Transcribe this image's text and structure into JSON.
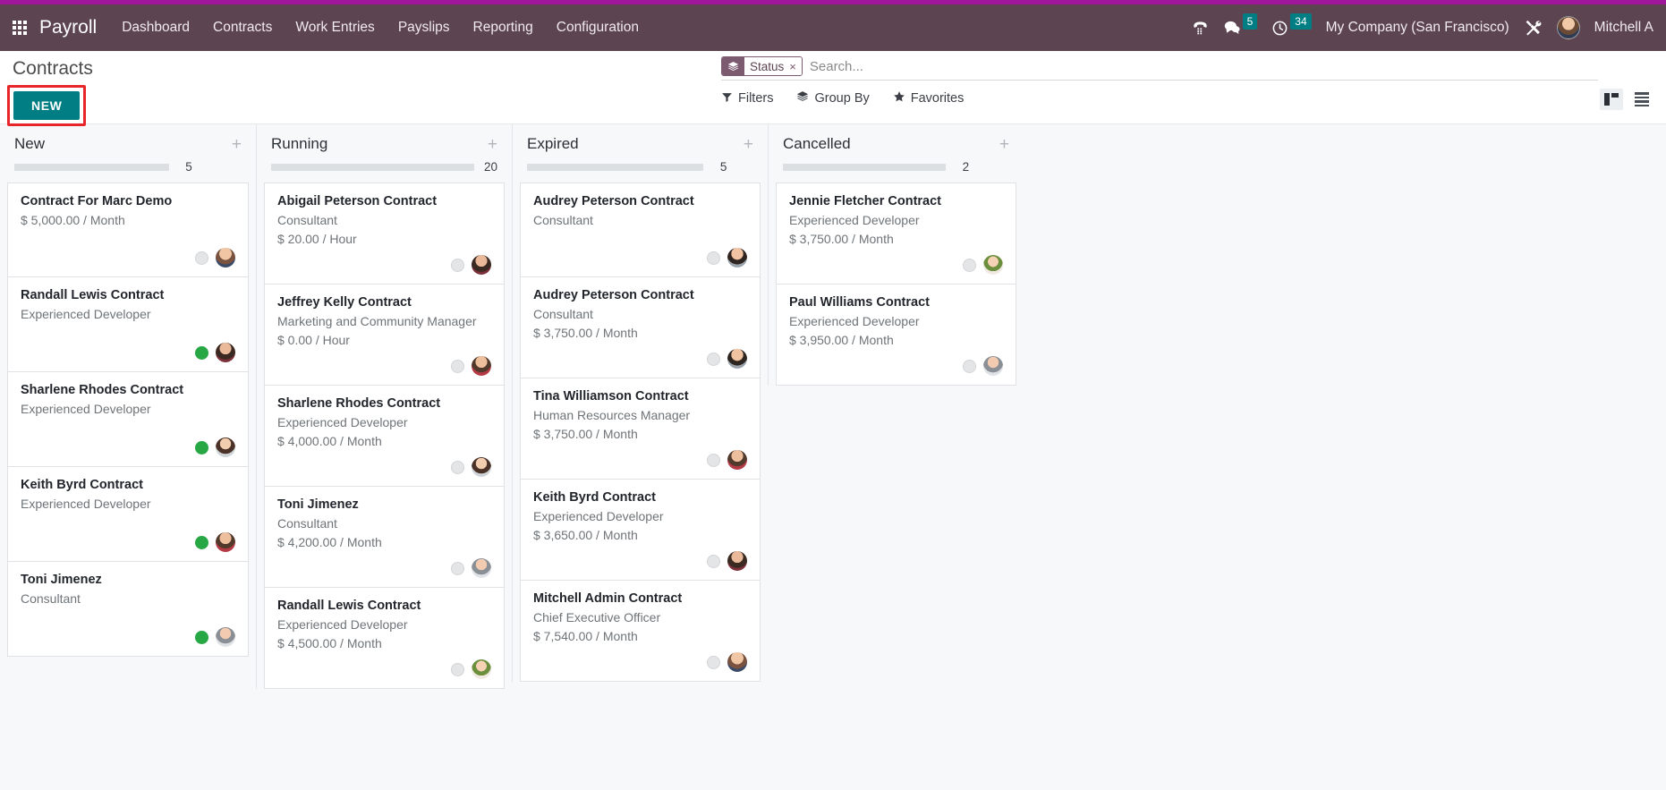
{
  "navbar": {
    "apps_icon": "apps-grid-icon",
    "brand": "Payroll",
    "menu": [
      {
        "label": "Dashboard"
      },
      {
        "label": "Contracts"
      },
      {
        "label": "Work Entries"
      },
      {
        "label": "Payslips"
      },
      {
        "label": "Reporting"
      },
      {
        "label": "Configuration"
      }
    ],
    "phone_icon": "phone-dialpad-icon",
    "messages_icon": "chat-bubble-icon",
    "messages_count": "5",
    "activities_icon": "clock-icon",
    "activities_count": "34",
    "company": "My Company (San Francisco)",
    "tools_icon": "wrench-screwdriver-icon",
    "user": "Mitchell A",
    "badge_color": "#017e84",
    "bar_color": "#5c4451",
    "strip_color": "#a0169b"
  },
  "control_panel": {
    "title": "Contracts",
    "new_button": "NEW",
    "new_button_color": "#017e84",
    "highlight_color": "#e8262a",
    "facet": {
      "icon": "layers-icon",
      "label": "Status",
      "remove": "×"
    },
    "search_placeholder": "Search...",
    "search_value": "",
    "filters": [
      {
        "icon": "funnel-icon",
        "label": "Filters"
      },
      {
        "icon": "layers-icon",
        "label": "Group By"
      },
      {
        "icon": "star-icon",
        "label": "Favorites"
      }
    ],
    "views": [
      {
        "icon": "kanban-view-icon",
        "active": true
      },
      {
        "icon": "list-view-icon",
        "active": false
      }
    ]
  },
  "kanban": {
    "add_label": "+",
    "columns": [
      {
        "title": "New",
        "count": "5",
        "progress_width": "68%",
        "cards": [
          {
            "title": "Contract For Marc Demo",
            "position": "",
            "amount": "$ 5,000.00 / Month",
            "status": "empty",
            "avatar": "av1"
          },
          {
            "title": "Randall Lewis Contract",
            "position": "Experienced Developer",
            "amount": "",
            "status": "green",
            "avatar": "av2"
          },
          {
            "title": "Sharlene Rhodes Contract",
            "position": "Experienced Developer",
            "amount": "",
            "status": "green",
            "avatar": "av3"
          },
          {
            "title": "Keith Byrd Contract",
            "position": "Experienced Developer",
            "amount": "",
            "status": "green",
            "avatar": "av6"
          },
          {
            "title": "Toni Jimenez",
            "position": "Consultant",
            "amount": "",
            "status": "green",
            "avatar": "av7"
          }
        ]
      },
      {
        "title": "Running",
        "count": "20",
        "progress_width": "100%",
        "cards": [
          {
            "title": "Abigail Peterson Contract",
            "position": "Consultant",
            "amount": "$ 20.00 / Hour",
            "status": "empty",
            "avatar": "av2"
          },
          {
            "title": "Jeffrey Kelly Contract",
            "position": "Marketing and Community Manager",
            "amount": "$ 0.00 / Hour",
            "status": "empty",
            "avatar": "av6"
          },
          {
            "title": "Sharlene Rhodes Contract",
            "position": "Experienced Developer",
            "amount": "$ 4,000.00 / Month",
            "status": "empty",
            "avatar": "av3"
          },
          {
            "title": "Toni Jimenez",
            "position": "Consultant",
            "amount": "$ 4,200.00 / Month",
            "status": "empty",
            "avatar": "av7"
          },
          {
            "title": "Randall Lewis Contract",
            "position": "Experienced Developer",
            "amount": "$ 4,500.00 / Month",
            "status": "empty",
            "avatar": "av5"
          }
        ]
      },
      {
        "title": "Expired",
        "count": "5",
        "progress_width": "78%",
        "cards": [
          {
            "title": "Audrey Peterson Contract",
            "position": "Consultant",
            "amount": "",
            "status": "empty",
            "avatar": "av4"
          },
          {
            "title": "Audrey Peterson Contract",
            "position": "Consultant",
            "amount": "$ 3,750.00 / Month",
            "status": "empty",
            "avatar": "av4"
          },
          {
            "title": "Tina Williamson Contract",
            "position": "Human Resources Manager",
            "amount": "$ 3,750.00 / Month",
            "status": "empty",
            "avatar": "av6"
          },
          {
            "title": "Keith Byrd Contract",
            "position": "Experienced Developer",
            "amount": "$ 3,650.00 / Month",
            "status": "empty",
            "avatar": "av2"
          },
          {
            "title": "Mitchell Admin Contract",
            "position": "Chief Executive Officer",
            "amount": "$ 7,540.00 / Month",
            "status": "empty",
            "avatar": "av1"
          }
        ]
      },
      {
        "title": "Cancelled",
        "count": "2",
        "progress_width": "72%",
        "cards": [
          {
            "title": "Jennie Fletcher Contract",
            "position": "Experienced Developer",
            "amount": "$ 3,750.00 / Month",
            "status": "empty",
            "avatar": "av5"
          },
          {
            "title": "Paul Williams Contract",
            "position": "Experienced Developer",
            "amount": "$ 3,950.00 / Month",
            "status": "empty",
            "avatar": "av7"
          }
        ]
      }
    ]
  }
}
